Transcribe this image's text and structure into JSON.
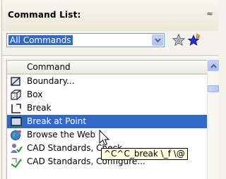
{
  "panel": {
    "title": "Command List:",
    "collapse_glyph": "≈"
  },
  "filter": {
    "value": "All Commands",
    "favorite_icon": "star-icon",
    "add_favorite_icon": "star-pin-icon"
  },
  "list": {
    "column_header": "Command",
    "items": [
      {
        "label": "Boundary...",
        "icon": "boundary-icon"
      },
      {
        "label": "Box",
        "icon": "box-icon"
      },
      {
        "label": "Break",
        "icon": "break-icon"
      },
      {
        "label": "Break at Point",
        "icon": "break-at-point-icon",
        "selected": true
      },
      {
        "label": "Browse the Web",
        "icon": "browse-web-icon"
      },
      {
        "label": "CAD Standards, Check...",
        "icon": "cad-standards-check-icon"
      },
      {
        "label": "CAD Standards, Configure...",
        "icon": "cad-standards-configure-icon"
      }
    ]
  },
  "tooltip": {
    "text": "^C^C_break \\_f \\@"
  },
  "colors": {
    "selection": "#316ac5",
    "tooltip_bg": "#ffffe1"
  }
}
